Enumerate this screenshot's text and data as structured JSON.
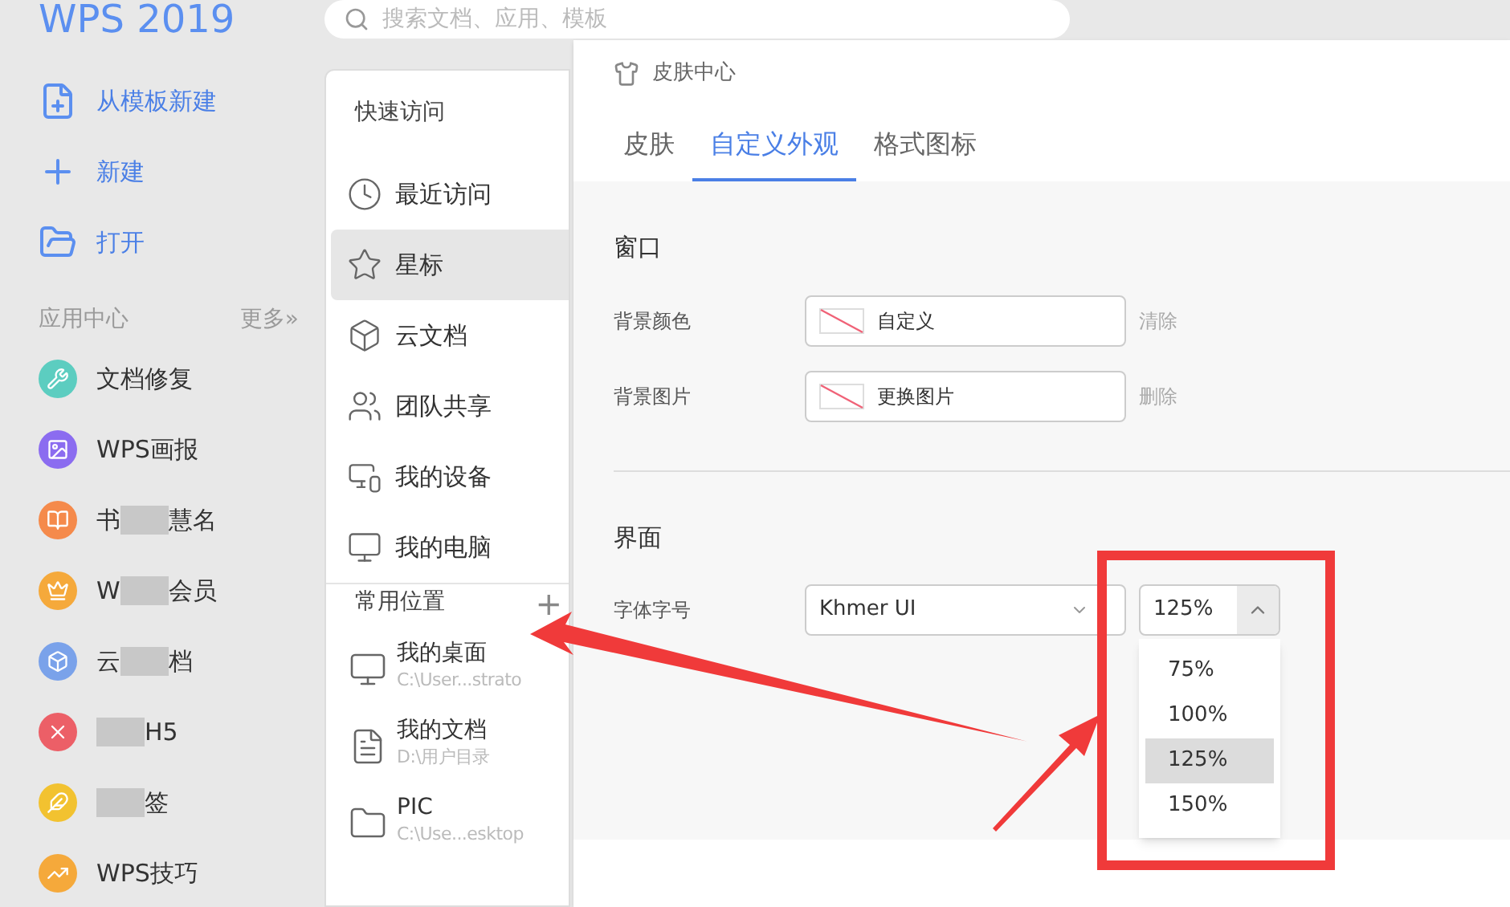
{
  "app": {
    "title": "WPS 2019",
    "search": {
      "placeholder": "搜索文档、应用、模板"
    }
  },
  "sidebar": {
    "actions": [
      {
        "label": "从模板新建",
        "kind": "template"
      },
      {
        "label": "新建",
        "kind": "new"
      },
      {
        "label": "打开",
        "kind": "open"
      }
    ],
    "app_center": {
      "title": "应用中心",
      "more": "更多»"
    },
    "apps": [
      {
        "kind": "repair",
        "color": "#5ccdc0",
        "parts": [
          {
            "kind": "text",
            "text": "文档修复"
          }
        ]
      },
      {
        "kind": "pictorial",
        "color": "#8b6cf0",
        "parts": [
          {
            "kind": "text",
            "text": "WPS画报"
          }
        ]
      },
      {
        "kind": "book",
        "color": "#f58a4b",
        "parts": [
          {
            "kind": "text",
            "text": "书"
          },
          {
            "kind": "pixelated"
          },
          {
            "kind": "text",
            "text": "慧名"
          }
        ]
      },
      {
        "kind": "crown",
        "color": "#f5a93b",
        "parts": [
          {
            "kind": "text",
            "text": "W"
          },
          {
            "kind": "pixelated"
          },
          {
            "kind": "text",
            "text": "会员"
          }
        ]
      },
      {
        "kind": "cube",
        "color": "#7aa2ea",
        "parts": [
          {
            "kind": "text",
            "text": "云"
          },
          {
            "kind": "pixelated"
          },
          {
            "kind": "text",
            "text": "档"
          }
        ]
      },
      {
        "kind": "h5",
        "color": "#ec5f67",
        "parts": [
          {
            "kind": "pixelated"
          },
          {
            "kind": "text",
            "text": "H5"
          }
        ]
      },
      {
        "kind": "note",
        "color": "#f2c230",
        "parts": [
          {
            "kind": "pixelated"
          },
          {
            "kind": "text",
            "text": "签"
          }
        ]
      },
      {
        "kind": "tips",
        "color": "#f5a93b",
        "parts": [
          {
            "kind": "text",
            "text": "WPS技巧"
          }
        ]
      }
    ]
  },
  "quick_access": {
    "title": "快速访问",
    "items": [
      {
        "label": "最近访问",
        "kind": "clock",
        "selected": false
      },
      {
        "label": "星标",
        "kind": "star",
        "selected": true
      },
      {
        "label": "云文档",
        "kind": "cube",
        "selected": false
      },
      {
        "label": "团队共享",
        "kind": "team",
        "selected": false
      },
      {
        "label": "我的设备",
        "kind": "devices",
        "selected": false
      },
      {
        "label": "我的电脑",
        "kind": "computer",
        "selected": false
      }
    ]
  },
  "common_places": {
    "title": "常用位置",
    "add": "+",
    "items": [
      {
        "name": "我的桌面",
        "path": "C:\\User...strato",
        "kind": "desktop"
      },
      {
        "name": "我的文档",
        "path": "D:\\用户目录",
        "kind": "documents"
      },
      {
        "name": "PIC",
        "path": "C:\\Use...esktop",
        "kind": "folder"
      }
    ]
  },
  "dialog": {
    "title": "皮肤中心",
    "tabs": [
      {
        "label": "皮肤",
        "selected": false
      },
      {
        "label": "自定义外观",
        "selected": true
      },
      {
        "label": "格式图标",
        "selected": false
      }
    ],
    "window_section": {
      "title": "窗口",
      "rows": [
        {
          "label": "背景颜色",
          "value": "自定义",
          "action": "清除"
        },
        {
          "label": "背景图片",
          "value": "更换图片",
          "action": "删除"
        }
      ]
    },
    "interface_section": {
      "title": "界面",
      "label": "字体字号",
      "font": "Khmer UI",
      "size": "125%",
      "expanded": true,
      "size_options": [
        {
          "label": "75%",
          "selected": false
        },
        {
          "label": "100%",
          "selected": false
        },
        {
          "label": "125%",
          "selected": true
        },
        {
          "label": "150%",
          "selected": false
        }
      ]
    }
  }
}
